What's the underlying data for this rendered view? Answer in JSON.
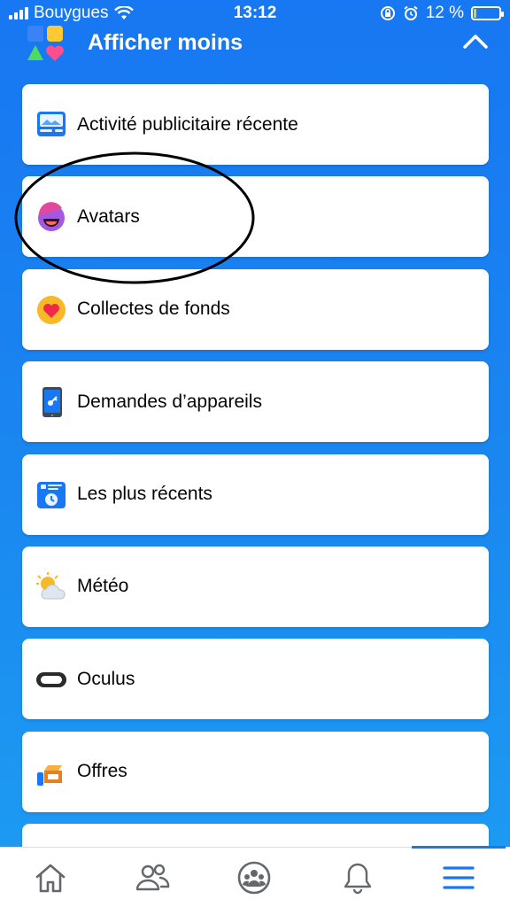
{
  "status_bar": {
    "carrier": "Bouygues",
    "time": "13:12",
    "battery_text": "12 %",
    "battery_level": 0.12
  },
  "header": {
    "title": "Afficher moins",
    "icon": "shortcuts-icon",
    "collapse_icon": "chevron-up-icon"
  },
  "menu": {
    "items": [
      {
        "label": "Activité publicitaire récente",
        "icon": "ad-activity-icon"
      },
      {
        "label": "Avatars",
        "icon": "avatar-icon"
      },
      {
        "label": "Collectes de fonds",
        "icon": "fundraiser-heart-icon"
      },
      {
        "label": "Demandes d’appareils",
        "icon": "device-request-icon"
      },
      {
        "label": "Les plus récents",
        "icon": "most-recent-icon"
      },
      {
        "label": "Météo",
        "icon": "weather-icon"
      },
      {
        "label": "Oculus",
        "icon": "oculus-icon"
      },
      {
        "label": "Offres",
        "icon": "offers-icon"
      }
    ]
  },
  "bottom_nav": {
    "items": [
      {
        "icon": "home-icon"
      },
      {
        "icon": "friends-icon"
      },
      {
        "icon": "groups-icon"
      },
      {
        "icon": "notifications-bell-icon"
      },
      {
        "icon": "menu-hamburger-icon",
        "active": true
      }
    ]
  },
  "colors": {
    "accent": "#1877f2",
    "background_top": "#1877f2",
    "background_bottom": "#1d9df2"
  }
}
